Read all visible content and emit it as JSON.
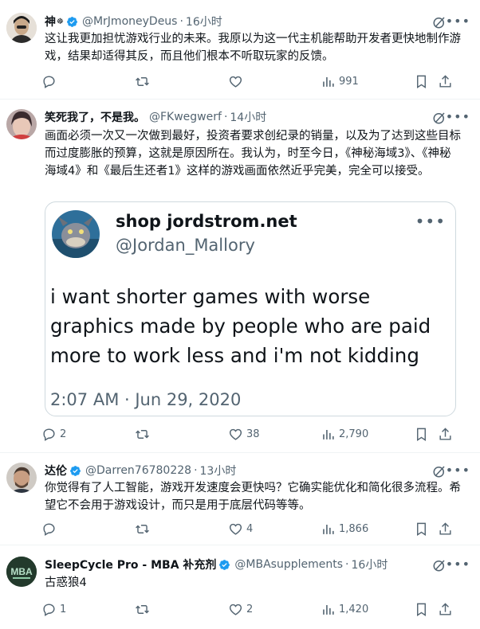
{
  "colors": {
    "verified": "#1d9bf0",
    "muted": "#536471",
    "text": "#0f1419",
    "border": "#eff3f4"
  },
  "posts": [
    {
      "author": "神",
      "author_emoji": "☸",
      "verified": true,
      "handle": "@MrJmoneyDeus",
      "time": "16小时",
      "text": "这让我更加担忧游戏行业的未来。我原以为这一代主机能帮助开发者更快地制作游戏，结果却适得其反，而且他们根本不听取玩家的反馈。",
      "replies": "",
      "retweets": "",
      "likes": "",
      "views": "991"
    },
    {
      "author": "笑死我了，不是我。",
      "verified": false,
      "handle": "@FKwegwerf",
      "time": "14小时",
      "text": "画面必须一次又一次做到最好，投资者要求创纪录的销量，以及为了达到这些目标而过度膨胀的预算，这就是原因所在。我认为，时至今日，《神秘海域3》、《神秘海域4》和《最后生还者1》这样的游戏画面依然近乎完美，完全可以接受。",
      "quoted": {
        "name": "shop jordstrom.net",
        "handle": "@Jordan_Mallory",
        "text": "i want shorter games with worse graphics made by people who are paid more to work less and i'm not kidding",
        "time": "2:07 AM · Jun 29, 2020"
      },
      "replies": "2",
      "retweets": "",
      "likes": "38",
      "views": "2,790"
    },
    {
      "author": "达伦",
      "verified": true,
      "handle": "@Darren76780228",
      "time": "13小时",
      "text": "你觉得有了人工智能，游戏开发速度会更快吗？它确实能优化和简化很多流程。希望它不会用于游戏设计，而只是用于底层代码等等。",
      "replies": "",
      "retweets": "",
      "likes": "4",
      "views": "1,866"
    },
    {
      "author": "SleepCycle Pro - MBA 补充剂",
      "verified": true,
      "handle": "@MBAsupplements",
      "time": "16小时",
      "text": "古惑狼4",
      "avatar_text": "MBA",
      "replies": "1",
      "retweets": "",
      "likes": "2",
      "views": "1,420"
    }
  ]
}
